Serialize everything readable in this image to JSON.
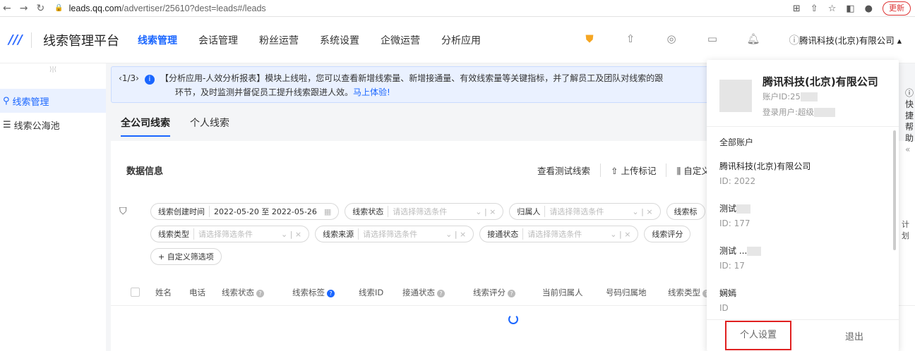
{
  "browser": {
    "url_host": "leads.qq.com",
    "url_path": "/advertiser/25610?dest=leads#/leads",
    "update_label": "更新"
  },
  "header": {
    "app_name": "线索管理平台",
    "menu": [
      "线索管理",
      "会话管理",
      "粉丝运营",
      "系统设置",
      "企微运营",
      "分析应用"
    ],
    "company": "腾讯科技(北京)有限公司 ▴"
  },
  "sidebar": {
    "items": [
      "线索管理",
      "线索公海池"
    ]
  },
  "banner": {
    "counter": "1/3",
    "line1": "【分析应用-人效分析报表】模块上线啦，您可以查看新增线索量、新增接通量、有效线索量等关键指标，并了解员工及团队对线索的跟",
    "line2": "环节，及时监测并督促员工提升线索跟进人效。",
    "link": "马上体验!"
  },
  "tabs": [
    "全公司线索",
    "个人线索"
  ],
  "card": {
    "title": "数据信息",
    "actions": [
      "查看测试线索",
      "⇧ 上传标记",
      "⫼ 自定义"
    ]
  },
  "filters": {
    "row1": [
      {
        "label": "线索创建时间",
        "value": "2022-05-20 至 2022-05-26"
      },
      {
        "label": "线索状态",
        "ph": "请选择筛选条件"
      },
      {
        "label": "归属人",
        "ph": "请选择筛选条件"
      },
      {
        "label": "线索标"
      }
    ],
    "row2": [
      {
        "label": "线索类型",
        "ph": "请选择筛选条件"
      },
      {
        "label": "线索来源",
        "ph": "请选择筛选条件"
      },
      {
        "label": "接通状态",
        "ph": "请选择筛选条件"
      },
      {
        "label": "线索评分"
      }
    ],
    "custom": "+ 自定义筛选项"
  },
  "table": {
    "headers": [
      "姓名",
      "电话",
      "线索状态",
      "线索标签",
      "线索ID",
      "接通状态",
      "线索评分",
      "当前归属人",
      "号码归属地",
      "线索类型"
    ],
    "last_col": "计划"
  },
  "popover": {
    "company": "腾讯科技(北京)有限公司",
    "account_id": "账户ID:25",
    "login_user": "登录用户:超级",
    "all_accounts": "全部账户",
    "accounts": [
      {
        "name": "腾讯科技(北京)有限公司",
        "id": "ID: 2022"
      },
      {
        "name": "测试",
        "id": "ID: 177"
      },
      {
        "name": "测试 ...",
        "id": "ID: 17"
      },
      {
        "name": "娴嫣",
        "id": "ID"
      }
    ],
    "personal_settings": "个人设置",
    "logout": "退出"
  },
  "right_tab": "快捷帮助"
}
